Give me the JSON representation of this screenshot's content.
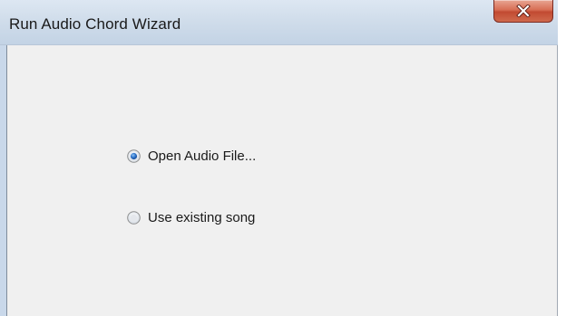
{
  "window": {
    "title": "Run Audio Chord Wizard"
  },
  "options": [
    {
      "label": "Open Audio File...",
      "selected": true
    },
    {
      "label": "Use existing song",
      "selected": false
    }
  ],
  "icons": {
    "close": "close-icon",
    "radio_selected": "radio-selected-icon",
    "radio_unselected": "radio-unselected-icon"
  },
  "colors": {
    "close_button": "#c94e36",
    "radio_dot": "#2a6fc6",
    "client_background": "#f0f0f0"
  }
}
